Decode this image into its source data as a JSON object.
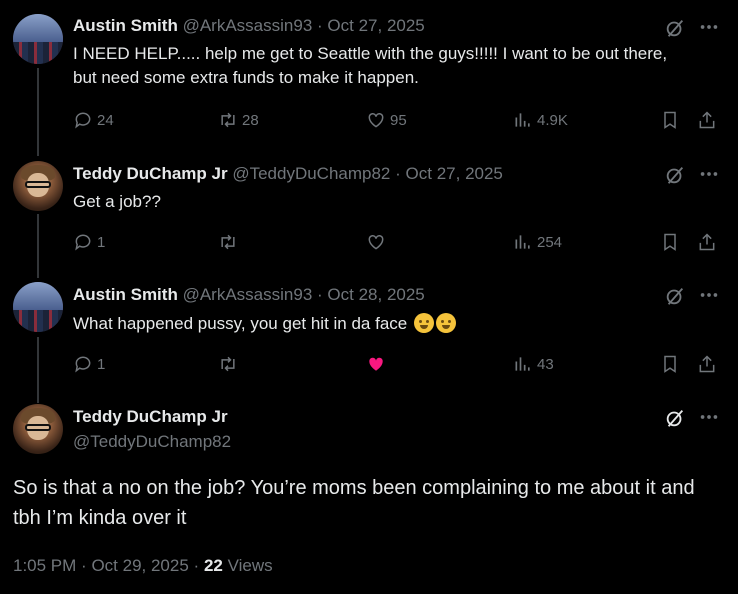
{
  "colors": {
    "background": "#000000",
    "text": "#e7e9ea",
    "secondary": "#71767b",
    "like_active": "#f91880",
    "line": "#333639"
  },
  "tweets": [
    {
      "name": "Austin Smith",
      "handle": "@ArkAssassin93",
      "date": "Oct 27, 2025",
      "text": "I NEED HELP..... help me get to Seattle with the guys!!!!! I want to be out there, but need some extra funds to make it happen.",
      "replies": "24",
      "retweets": "28",
      "likes": "95",
      "views": "4.9K",
      "liked": false
    },
    {
      "name": "Teddy DuChamp Jr",
      "handle": "@TeddyDuChamp82",
      "date": "Oct 27, 2025",
      "text": "Get a job??",
      "replies": "1",
      "retweets": "",
      "likes": "",
      "views": "254",
      "liked": false
    },
    {
      "name": "Austin Smith",
      "handle": "@ArkAssassin93",
      "date": "Oct 28, 2025",
      "text": "What happened pussy, you get hit in da face",
      "emoji_icons": [
        "woozy-face-icon",
        "grinning-squinting-face-icon"
      ],
      "replies": "1",
      "retweets": "",
      "likes": "",
      "views": "43",
      "liked": true
    }
  ],
  "main": {
    "name": "Teddy DuChamp Jr",
    "handle": "@TeddyDuChamp82",
    "text": "So is that a no on the job? You’re moms been complaining to me about it and tbh I’m kinda over it",
    "time": "1:05 PM",
    "date": "Oct 29, 2025",
    "views_count": "22",
    "views_label": "Views"
  },
  "separator": "·"
}
